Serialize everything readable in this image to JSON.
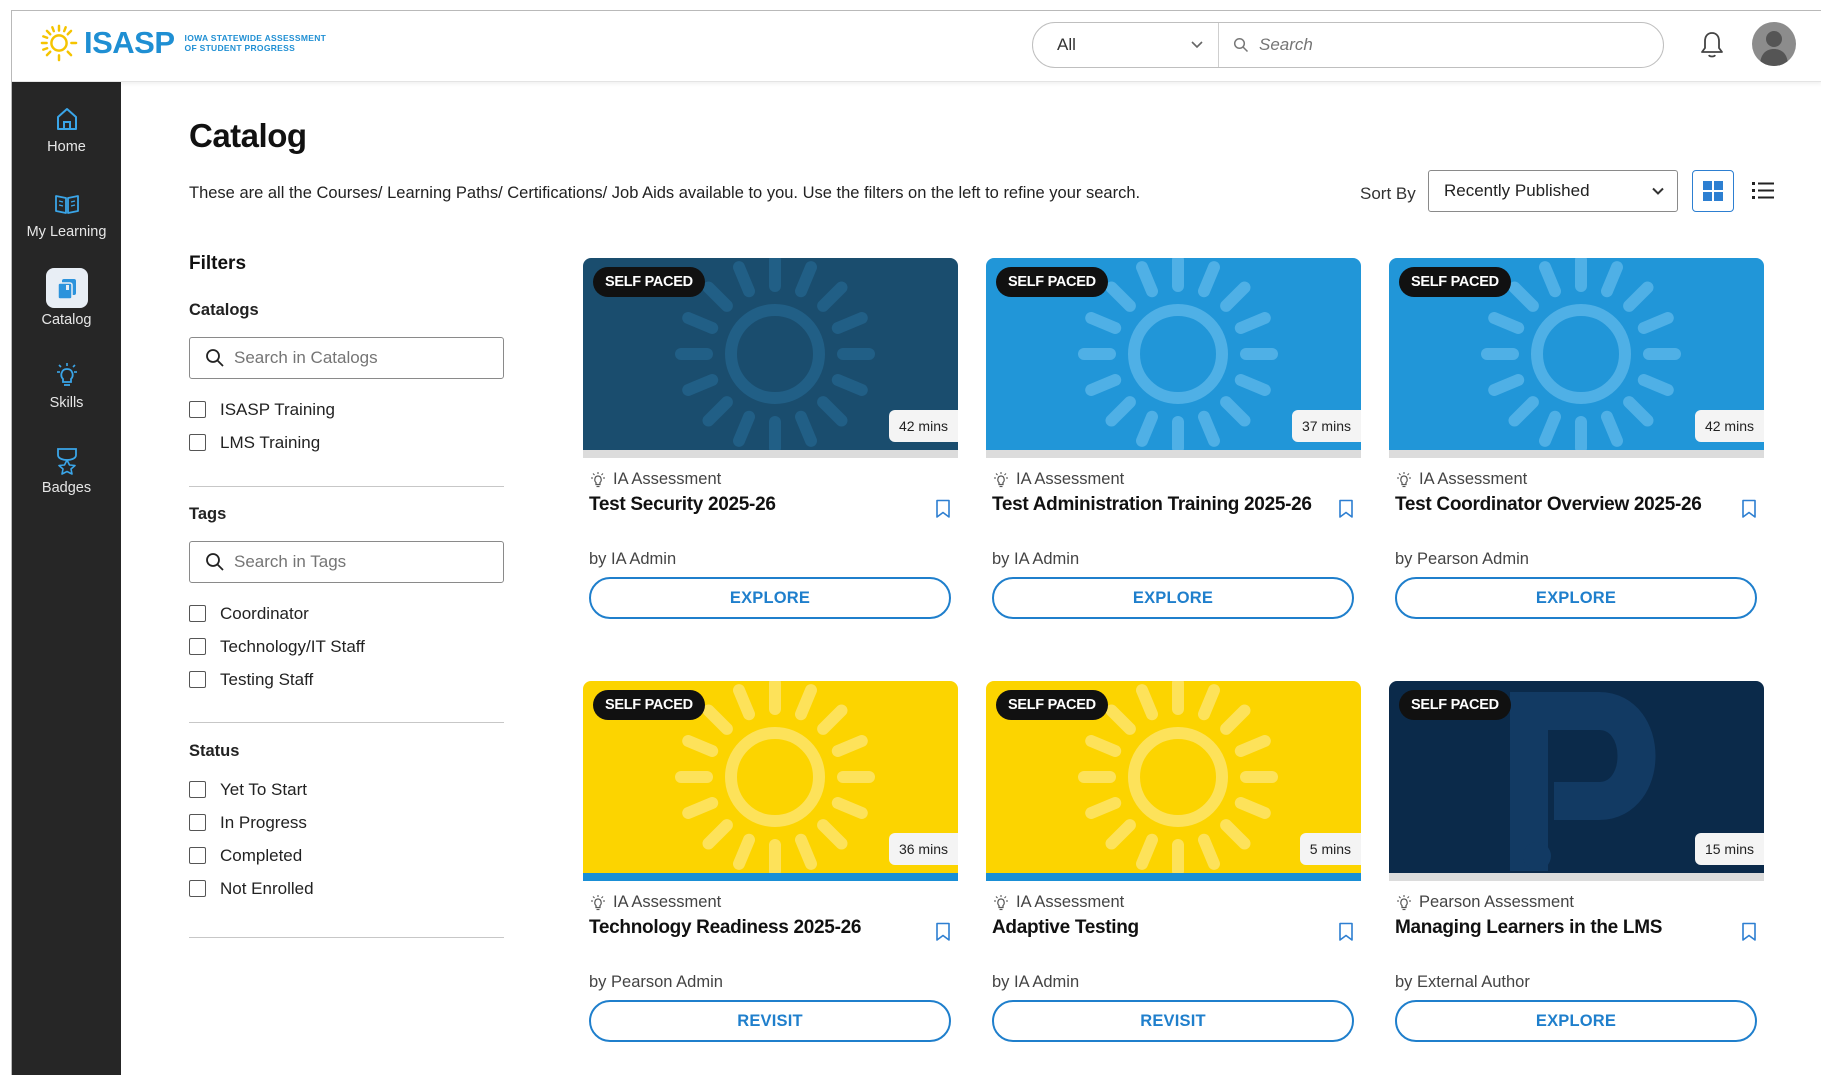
{
  "brand": {
    "name": "ISASP",
    "subtitle_line1": "IOWA STATEWIDE ASSESSMENT",
    "subtitle_line2": "of STUDENT PROGRESS"
  },
  "header": {
    "scope_value": "All",
    "search_placeholder": "Search"
  },
  "sidebar": {
    "items": [
      {
        "label": "Home",
        "icon": "home-icon"
      },
      {
        "label": "My Learning",
        "icon": "book-icon"
      },
      {
        "label": "Catalog",
        "icon": "catalog-icon"
      },
      {
        "label": "Skills",
        "icon": "lightbulb-icon"
      },
      {
        "label": "Badges",
        "icon": "badge-icon"
      }
    ]
  },
  "main": {
    "title": "Catalog",
    "description": "These are all the Courses/ Learning Paths/ Certifications/ Job Aids available to you. Use the filters on the left to refine your search.",
    "sort_label": "Sort By",
    "sort_value": "Recently Published"
  },
  "filters": {
    "title": "Filters",
    "catalogs": {
      "heading": "Catalogs",
      "search_placeholder": "Search in Catalogs",
      "options": [
        "ISASP Training",
        "LMS Training"
      ]
    },
    "tags": {
      "heading": "Tags",
      "search_placeholder": "Search in Tags",
      "options": [
        "Coordinator",
        "Technology/IT Staff",
        "Testing Staff"
      ]
    },
    "status": {
      "heading": "Status",
      "options": [
        "Yet To Start",
        "In Progress",
        "Completed",
        "Not Enrolled"
      ]
    }
  },
  "cards": [
    {
      "badge": "SELF PACED",
      "duration": "42 mins",
      "category": "IA Assessment",
      "title": "Test Security 2025-26",
      "author": "by IA Admin",
      "action": "EXPLORE",
      "theme": "#1a4d6e",
      "sun": "#215f86",
      "progress": 0
    },
    {
      "badge": "SELF PACED",
      "duration": "37 mins",
      "category": "IA Assessment",
      "title": "Test Administration Training 2025-26",
      "author": "by IA Admin",
      "action": "EXPLORE",
      "theme": "#2196d8",
      "sun": "#4fb0e6",
      "progress": 0
    },
    {
      "badge": "SELF PACED",
      "duration": "42 mins",
      "category": "IA Assessment",
      "title": "Test Coordinator Overview 2025-26",
      "author": "by Pearson Admin",
      "action": "EXPLORE",
      "theme": "#2196d8",
      "sun": "#4fb0e6",
      "progress": 0
    },
    {
      "badge": "SELF PACED",
      "duration": "36 mins",
      "category": "IA Assessment",
      "title": "Technology Readiness 2025-26",
      "author": "by Pearson Admin",
      "action": "REVISIT",
      "theme": "#fcd400",
      "sun": "#fde25a",
      "progress": 1
    },
    {
      "badge": "SELF PACED",
      "duration": "5 mins",
      "category": "IA Assessment",
      "title": "Adaptive Testing",
      "author": "by IA Admin",
      "action": "REVISIT",
      "theme": "#fcd400",
      "sun": "#fde25a",
      "progress": 1
    },
    {
      "badge": "SELF PACED",
      "duration": "15 mins",
      "category": "Pearson Assessment",
      "title": "Managing Learners in the LMS",
      "author": "by External Author",
      "action": "EXPLORE",
      "theme": "#0b2a4a",
      "sun": "#123a63",
      "progress": 0
    }
  ]
}
